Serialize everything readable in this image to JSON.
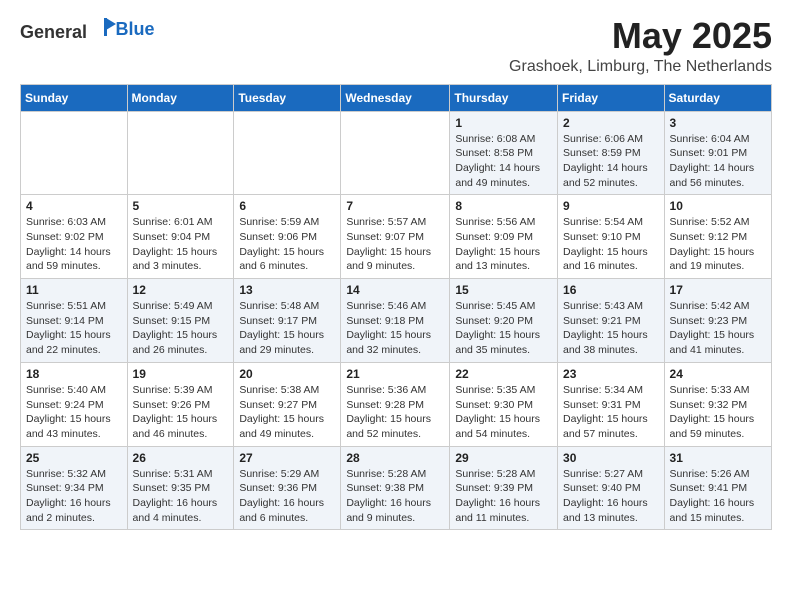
{
  "app": {
    "logo_general": "General",
    "logo_blue": "Blue"
  },
  "header": {
    "month": "May 2025",
    "location": "Grashoek, Limburg, The Netherlands"
  },
  "weekdays": [
    "Sunday",
    "Monday",
    "Tuesday",
    "Wednesday",
    "Thursday",
    "Friday",
    "Saturday"
  ],
  "weeks": [
    [
      {
        "day": "",
        "text": ""
      },
      {
        "day": "",
        "text": ""
      },
      {
        "day": "",
        "text": ""
      },
      {
        "day": "",
        "text": ""
      },
      {
        "day": "1",
        "text": "Sunrise: 6:08 AM\nSunset: 8:58 PM\nDaylight: 14 hours\nand 49 minutes."
      },
      {
        "day": "2",
        "text": "Sunrise: 6:06 AM\nSunset: 8:59 PM\nDaylight: 14 hours\nand 52 minutes."
      },
      {
        "day": "3",
        "text": "Sunrise: 6:04 AM\nSunset: 9:01 PM\nDaylight: 14 hours\nand 56 minutes."
      }
    ],
    [
      {
        "day": "4",
        "text": "Sunrise: 6:03 AM\nSunset: 9:02 PM\nDaylight: 14 hours\nand 59 minutes."
      },
      {
        "day": "5",
        "text": "Sunrise: 6:01 AM\nSunset: 9:04 PM\nDaylight: 15 hours\nand 3 minutes."
      },
      {
        "day": "6",
        "text": "Sunrise: 5:59 AM\nSunset: 9:06 PM\nDaylight: 15 hours\nand 6 minutes."
      },
      {
        "day": "7",
        "text": "Sunrise: 5:57 AM\nSunset: 9:07 PM\nDaylight: 15 hours\nand 9 minutes."
      },
      {
        "day": "8",
        "text": "Sunrise: 5:56 AM\nSunset: 9:09 PM\nDaylight: 15 hours\nand 13 minutes."
      },
      {
        "day": "9",
        "text": "Sunrise: 5:54 AM\nSunset: 9:10 PM\nDaylight: 15 hours\nand 16 minutes."
      },
      {
        "day": "10",
        "text": "Sunrise: 5:52 AM\nSunset: 9:12 PM\nDaylight: 15 hours\nand 19 minutes."
      }
    ],
    [
      {
        "day": "11",
        "text": "Sunrise: 5:51 AM\nSunset: 9:14 PM\nDaylight: 15 hours\nand 22 minutes."
      },
      {
        "day": "12",
        "text": "Sunrise: 5:49 AM\nSunset: 9:15 PM\nDaylight: 15 hours\nand 26 minutes."
      },
      {
        "day": "13",
        "text": "Sunrise: 5:48 AM\nSunset: 9:17 PM\nDaylight: 15 hours\nand 29 minutes."
      },
      {
        "day": "14",
        "text": "Sunrise: 5:46 AM\nSunset: 9:18 PM\nDaylight: 15 hours\nand 32 minutes."
      },
      {
        "day": "15",
        "text": "Sunrise: 5:45 AM\nSunset: 9:20 PM\nDaylight: 15 hours\nand 35 minutes."
      },
      {
        "day": "16",
        "text": "Sunrise: 5:43 AM\nSunset: 9:21 PM\nDaylight: 15 hours\nand 38 minutes."
      },
      {
        "day": "17",
        "text": "Sunrise: 5:42 AM\nSunset: 9:23 PM\nDaylight: 15 hours\nand 41 minutes."
      }
    ],
    [
      {
        "day": "18",
        "text": "Sunrise: 5:40 AM\nSunset: 9:24 PM\nDaylight: 15 hours\nand 43 minutes."
      },
      {
        "day": "19",
        "text": "Sunrise: 5:39 AM\nSunset: 9:26 PM\nDaylight: 15 hours\nand 46 minutes."
      },
      {
        "day": "20",
        "text": "Sunrise: 5:38 AM\nSunset: 9:27 PM\nDaylight: 15 hours\nand 49 minutes."
      },
      {
        "day": "21",
        "text": "Sunrise: 5:36 AM\nSunset: 9:28 PM\nDaylight: 15 hours\nand 52 minutes."
      },
      {
        "day": "22",
        "text": "Sunrise: 5:35 AM\nSunset: 9:30 PM\nDaylight: 15 hours\nand 54 minutes."
      },
      {
        "day": "23",
        "text": "Sunrise: 5:34 AM\nSunset: 9:31 PM\nDaylight: 15 hours\nand 57 minutes."
      },
      {
        "day": "24",
        "text": "Sunrise: 5:33 AM\nSunset: 9:32 PM\nDaylight: 15 hours\nand 59 minutes."
      }
    ],
    [
      {
        "day": "25",
        "text": "Sunrise: 5:32 AM\nSunset: 9:34 PM\nDaylight: 16 hours\nand 2 minutes."
      },
      {
        "day": "26",
        "text": "Sunrise: 5:31 AM\nSunset: 9:35 PM\nDaylight: 16 hours\nand 4 minutes."
      },
      {
        "day": "27",
        "text": "Sunrise: 5:29 AM\nSunset: 9:36 PM\nDaylight: 16 hours\nand 6 minutes."
      },
      {
        "day": "28",
        "text": "Sunrise: 5:28 AM\nSunset: 9:38 PM\nDaylight: 16 hours\nand 9 minutes."
      },
      {
        "day": "29",
        "text": "Sunrise: 5:28 AM\nSunset: 9:39 PM\nDaylight: 16 hours\nand 11 minutes."
      },
      {
        "day": "30",
        "text": "Sunrise: 5:27 AM\nSunset: 9:40 PM\nDaylight: 16 hours\nand 13 minutes."
      },
      {
        "day": "31",
        "text": "Sunrise: 5:26 AM\nSunset: 9:41 PM\nDaylight: 16 hours\nand 15 minutes."
      }
    ]
  ]
}
